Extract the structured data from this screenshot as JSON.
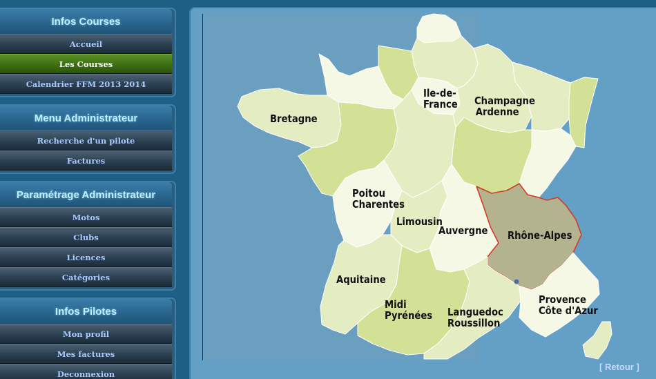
{
  "sidebar": {
    "sections": [
      {
        "title": "Infos Courses",
        "items": [
          {
            "label": "Accueil",
            "active": false
          },
          {
            "label": "Les Courses",
            "active": true
          },
          {
            "label": "Calendrier FFM 2013 2014",
            "active": false
          }
        ]
      },
      {
        "title": "Menu Administrateur",
        "items": [
          {
            "label": "Recherche d'un pilote",
            "active": false
          },
          {
            "label": "Factures",
            "active": false
          }
        ]
      },
      {
        "title": "Paramétrage Administrateur",
        "items": [
          {
            "label": "Motos",
            "active": false
          },
          {
            "label": "Clubs",
            "active": false
          },
          {
            "label": "Licences",
            "active": false
          },
          {
            "label": "Catégories",
            "active": false
          }
        ]
      },
      {
        "title": "Infos Pilotes",
        "items": [
          {
            "label": "Mon profil",
            "active": false
          },
          {
            "label": "Mes factures",
            "active": false
          },
          {
            "label": "Deconnexion",
            "active": false
          }
        ]
      }
    ]
  },
  "map": {
    "regions": {
      "bretagne": "Bretagne",
      "ile_de_france": [
        "Ile-de-",
        "France"
      ],
      "champagne_ardenne": [
        "Champagne",
        "Ardenne"
      ],
      "poitou_charentes": [
        "Poitou",
        "Charentes"
      ],
      "limousin": "Limousin",
      "auvergne": "Auvergne",
      "rhone_alpes": "Rhône-Alpes",
      "aquitaine": "Aquitaine",
      "midi_pyrenees": [
        "Midi",
        "Pyrénées"
      ],
      "languedoc_roussillon": [
        "Languedoc",
        "Roussillon"
      ],
      "provence_cote_dazur": [
        "Provence",
        "Côte d'Azur"
      ]
    },
    "selected_region": "Rhône-Alpes"
  },
  "footer": {
    "retour_label": "[ Retour ]"
  },
  "colors": {
    "page_bg": "#1e5f86",
    "panel_bg": "#64a0c6",
    "sea": "#6b9fc0",
    "region_white": "#f6f8e6",
    "region_light": "#e4ecc2",
    "region_mid": "#d3e196",
    "selected_fill": "#b3b38f",
    "selected_border": "#d33a2a",
    "menu_active": "#3f7214"
  }
}
